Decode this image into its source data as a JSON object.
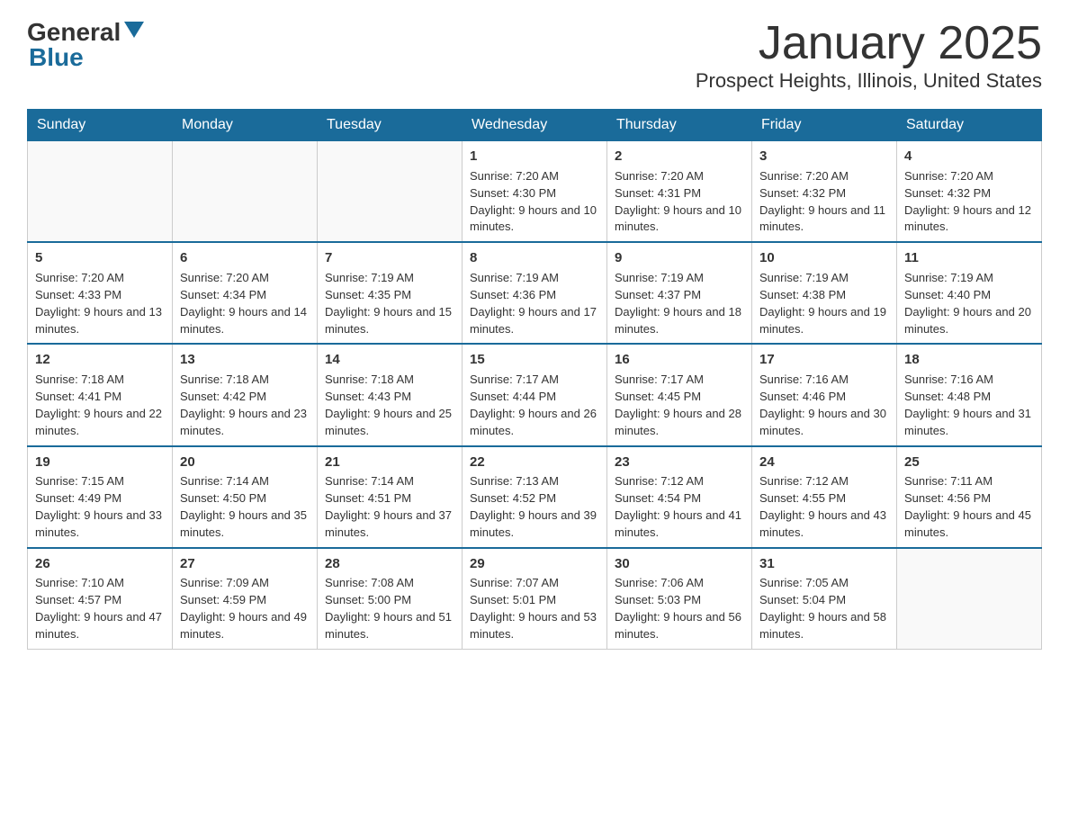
{
  "header": {
    "logo_general": "General",
    "logo_blue": "Blue",
    "month_title": "January 2025",
    "location": "Prospect Heights, Illinois, United States"
  },
  "weekdays": [
    "Sunday",
    "Monday",
    "Tuesday",
    "Wednesday",
    "Thursday",
    "Friday",
    "Saturday"
  ],
  "weeks": [
    {
      "days": [
        {
          "num": "",
          "sunrise": "",
          "sunset": "",
          "daylight": "",
          "empty": true
        },
        {
          "num": "",
          "sunrise": "",
          "sunset": "",
          "daylight": "",
          "empty": true
        },
        {
          "num": "",
          "sunrise": "",
          "sunset": "",
          "daylight": "",
          "empty": true
        },
        {
          "num": "1",
          "sunrise": "Sunrise: 7:20 AM",
          "sunset": "Sunset: 4:30 PM",
          "daylight": "Daylight: 9 hours and 10 minutes.",
          "empty": false
        },
        {
          "num": "2",
          "sunrise": "Sunrise: 7:20 AM",
          "sunset": "Sunset: 4:31 PM",
          "daylight": "Daylight: 9 hours and 10 minutes.",
          "empty": false
        },
        {
          "num": "3",
          "sunrise": "Sunrise: 7:20 AM",
          "sunset": "Sunset: 4:32 PM",
          "daylight": "Daylight: 9 hours and 11 minutes.",
          "empty": false
        },
        {
          "num": "4",
          "sunrise": "Sunrise: 7:20 AM",
          "sunset": "Sunset: 4:32 PM",
          "daylight": "Daylight: 9 hours and 12 minutes.",
          "empty": false
        }
      ]
    },
    {
      "days": [
        {
          "num": "5",
          "sunrise": "Sunrise: 7:20 AM",
          "sunset": "Sunset: 4:33 PM",
          "daylight": "Daylight: 9 hours and 13 minutes.",
          "empty": false
        },
        {
          "num": "6",
          "sunrise": "Sunrise: 7:20 AM",
          "sunset": "Sunset: 4:34 PM",
          "daylight": "Daylight: 9 hours and 14 minutes.",
          "empty": false
        },
        {
          "num": "7",
          "sunrise": "Sunrise: 7:19 AM",
          "sunset": "Sunset: 4:35 PM",
          "daylight": "Daylight: 9 hours and 15 minutes.",
          "empty": false
        },
        {
          "num": "8",
          "sunrise": "Sunrise: 7:19 AM",
          "sunset": "Sunset: 4:36 PM",
          "daylight": "Daylight: 9 hours and 17 minutes.",
          "empty": false
        },
        {
          "num": "9",
          "sunrise": "Sunrise: 7:19 AM",
          "sunset": "Sunset: 4:37 PM",
          "daylight": "Daylight: 9 hours and 18 minutes.",
          "empty": false
        },
        {
          "num": "10",
          "sunrise": "Sunrise: 7:19 AM",
          "sunset": "Sunset: 4:38 PM",
          "daylight": "Daylight: 9 hours and 19 minutes.",
          "empty": false
        },
        {
          "num": "11",
          "sunrise": "Sunrise: 7:19 AM",
          "sunset": "Sunset: 4:40 PM",
          "daylight": "Daylight: 9 hours and 20 minutes.",
          "empty": false
        }
      ]
    },
    {
      "days": [
        {
          "num": "12",
          "sunrise": "Sunrise: 7:18 AM",
          "sunset": "Sunset: 4:41 PM",
          "daylight": "Daylight: 9 hours and 22 minutes.",
          "empty": false
        },
        {
          "num": "13",
          "sunrise": "Sunrise: 7:18 AM",
          "sunset": "Sunset: 4:42 PM",
          "daylight": "Daylight: 9 hours and 23 minutes.",
          "empty": false
        },
        {
          "num": "14",
          "sunrise": "Sunrise: 7:18 AM",
          "sunset": "Sunset: 4:43 PM",
          "daylight": "Daylight: 9 hours and 25 minutes.",
          "empty": false
        },
        {
          "num": "15",
          "sunrise": "Sunrise: 7:17 AM",
          "sunset": "Sunset: 4:44 PM",
          "daylight": "Daylight: 9 hours and 26 minutes.",
          "empty": false
        },
        {
          "num": "16",
          "sunrise": "Sunrise: 7:17 AM",
          "sunset": "Sunset: 4:45 PM",
          "daylight": "Daylight: 9 hours and 28 minutes.",
          "empty": false
        },
        {
          "num": "17",
          "sunrise": "Sunrise: 7:16 AM",
          "sunset": "Sunset: 4:46 PM",
          "daylight": "Daylight: 9 hours and 30 minutes.",
          "empty": false
        },
        {
          "num": "18",
          "sunrise": "Sunrise: 7:16 AM",
          "sunset": "Sunset: 4:48 PM",
          "daylight": "Daylight: 9 hours and 31 minutes.",
          "empty": false
        }
      ]
    },
    {
      "days": [
        {
          "num": "19",
          "sunrise": "Sunrise: 7:15 AM",
          "sunset": "Sunset: 4:49 PM",
          "daylight": "Daylight: 9 hours and 33 minutes.",
          "empty": false
        },
        {
          "num": "20",
          "sunrise": "Sunrise: 7:14 AM",
          "sunset": "Sunset: 4:50 PM",
          "daylight": "Daylight: 9 hours and 35 minutes.",
          "empty": false
        },
        {
          "num": "21",
          "sunrise": "Sunrise: 7:14 AM",
          "sunset": "Sunset: 4:51 PM",
          "daylight": "Daylight: 9 hours and 37 minutes.",
          "empty": false
        },
        {
          "num": "22",
          "sunrise": "Sunrise: 7:13 AM",
          "sunset": "Sunset: 4:52 PM",
          "daylight": "Daylight: 9 hours and 39 minutes.",
          "empty": false
        },
        {
          "num": "23",
          "sunrise": "Sunrise: 7:12 AM",
          "sunset": "Sunset: 4:54 PM",
          "daylight": "Daylight: 9 hours and 41 minutes.",
          "empty": false
        },
        {
          "num": "24",
          "sunrise": "Sunrise: 7:12 AM",
          "sunset": "Sunset: 4:55 PM",
          "daylight": "Daylight: 9 hours and 43 minutes.",
          "empty": false
        },
        {
          "num": "25",
          "sunrise": "Sunrise: 7:11 AM",
          "sunset": "Sunset: 4:56 PM",
          "daylight": "Daylight: 9 hours and 45 minutes.",
          "empty": false
        }
      ]
    },
    {
      "days": [
        {
          "num": "26",
          "sunrise": "Sunrise: 7:10 AM",
          "sunset": "Sunset: 4:57 PM",
          "daylight": "Daylight: 9 hours and 47 minutes.",
          "empty": false
        },
        {
          "num": "27",
          "sunrise": "Sunrise: 7:09 AM",
          "sunset": "Sunset: 4:59 PM",
          "daylight": "Daylight: 9 hours and 49 minutes.",
          "empty": false
        },
        {
          "num": "28",
          "sunrise": "Sunrise: 7:08 AM",
          "sunset": "Sunset: 5:00 PM",
          "daylight": "Daylight: 9 hours and 51 minutes.",
          "empty": false
        },
        {
          "num": "29",
          "sunrise": "Sunrise: 7:07 AM",
          "sunset": "Sunset: 5:01 PM",
          "daylight": "Daylight: 9 hours and 53 minutes.",
          "empty": false
        },
        {
          "num": "30",
          "sunrise": "Sunrise: 7:06 AM",
          "sunset": "Sunset: 5:03 PM",
          "daylight": "Daylight: 9 hours and 56 minutes.",
          "empty": false
        },
        {
          "num": "31",
          "sunrise": "Sunrise: 7:05 AM",
          "sunset": "Sunset: 5:04 PM",
          "daylight": "Daylight: 9 hours and 58 minutes.",
          "empty": false
        },
        {
          "num": "",
          "sunrise": "",
          "sunset": "",
          "daylight": "",
          "empty": true
        }
      ]
    }
  ]
}
